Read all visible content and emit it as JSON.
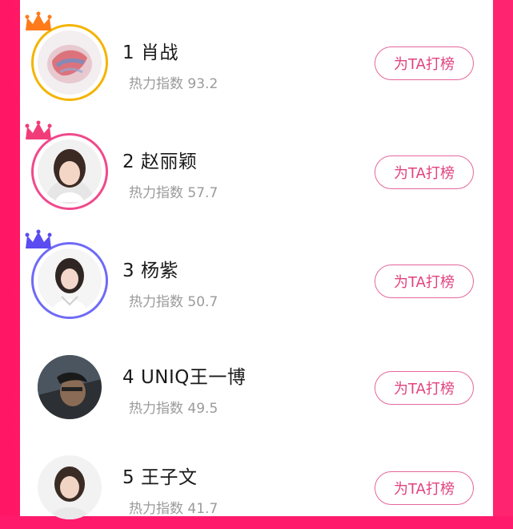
{
  "colors": {
    "frame": "#ff1a6c",
    "button_accent": "#e0437f",
    "rank1_ring": "#f4b400",
    "rank2_ring": "#f0498c",
    "rank3_ring": "#6f6af7",
    "rank1_crown": "#ff7a1a",
    "rank2_crown": "#f23c7a",
    "rank3_crown": "#5a4cf0"
  },
  "ranking": [
    {
      "rank_name": "1 肖战",
      "heat": "热力指数 93.2",
      "button": "为TA打榜",
      "crown_icon": "orange-crown-icon"
    },
    {
      "rank_name": "2 赵丽颖",
      "heat": "热力指数 57.7",
      "button": "为TA打榜",
      "crown_icon": "pink-crown-icon"
    },
    {
      "rank_name": "3 杨紫",
      "heat": "热力指数 50.7",
      "button": "为TA打榜",
      "crown_icon": "purple-crown-icon"
    },
    {
      "rank_name": "4 UNIQ王一博",
      "heat": "热力指数 49.5",
      "button": "为TA打榜"
    },
    {
      "rank_name": "5 王子文",
      "heat": "热力指数 41.7",
      "button": "为TA打榜"
    }
  ]
}
